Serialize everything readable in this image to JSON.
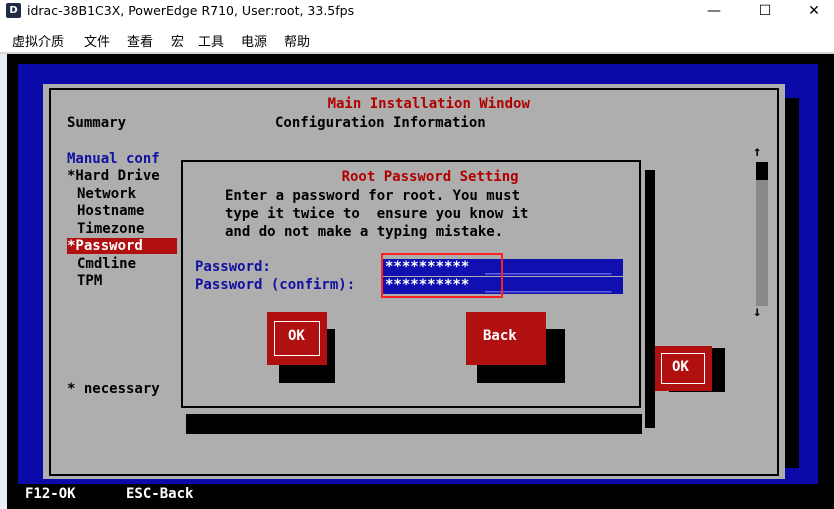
{
  "window": {
    "title": "idrac-38B1C3X, PowerEdge R710, User:root, 33.5fps",
    "app_icon_letter": "D",
    "minimize_glyph": "—",
    "maximize_glyph": "☐",
    "close_glyph": "✕"
  },
  "menu": [
    "虚拟介质",
    "文件",
    "查看",
    "宏",
    "工具",
    "电源",
    "帮助"
  ],
  "main_window": {
    "title": "Main Installation Window",
    "summary_label": "Summary",
    "config_label": "Configuration Information",
    "sidebar": {
      "items": [
        "Manual conf",
        "*Hard Drive",
        "Network",
        "Hostname",
        "Timezone",
        "*Password",
        "Cmdline",
        "TPM"
      ],
      "selected_index": 5
    },
    "necessary_note": "* necessary",
    "ok_label": "OK",
    "scroll_up": "↑",
    "scroll_down": "↓"
  },
  "dialog": {
    "title": "Root Password Setting",
    "message_lines": [
      "Enter a password for root. You must",
      "type it twice to  ensure you know it",
      "and do not make a typing mistake."
    ],
    "password_label": "Password:",
    "password_value": "**********",
    "confirm_label": "Password (confirm):",
    "confirm_value": "**********",
    "ok_label": "OK",
    "back_label": "Back"
  },
  "footer": {
    "f12": "F12-OK",
    "esc": "ESC-Back"
  },
  "colors": {
    "background_blue": "#0a0aa8",
    "panel_gray": "#aeaeae",
    "accent_red": "#b01010",
    "field_blue": "#1010b0",
    "highlight_red": "#ff2020"
  }
}
